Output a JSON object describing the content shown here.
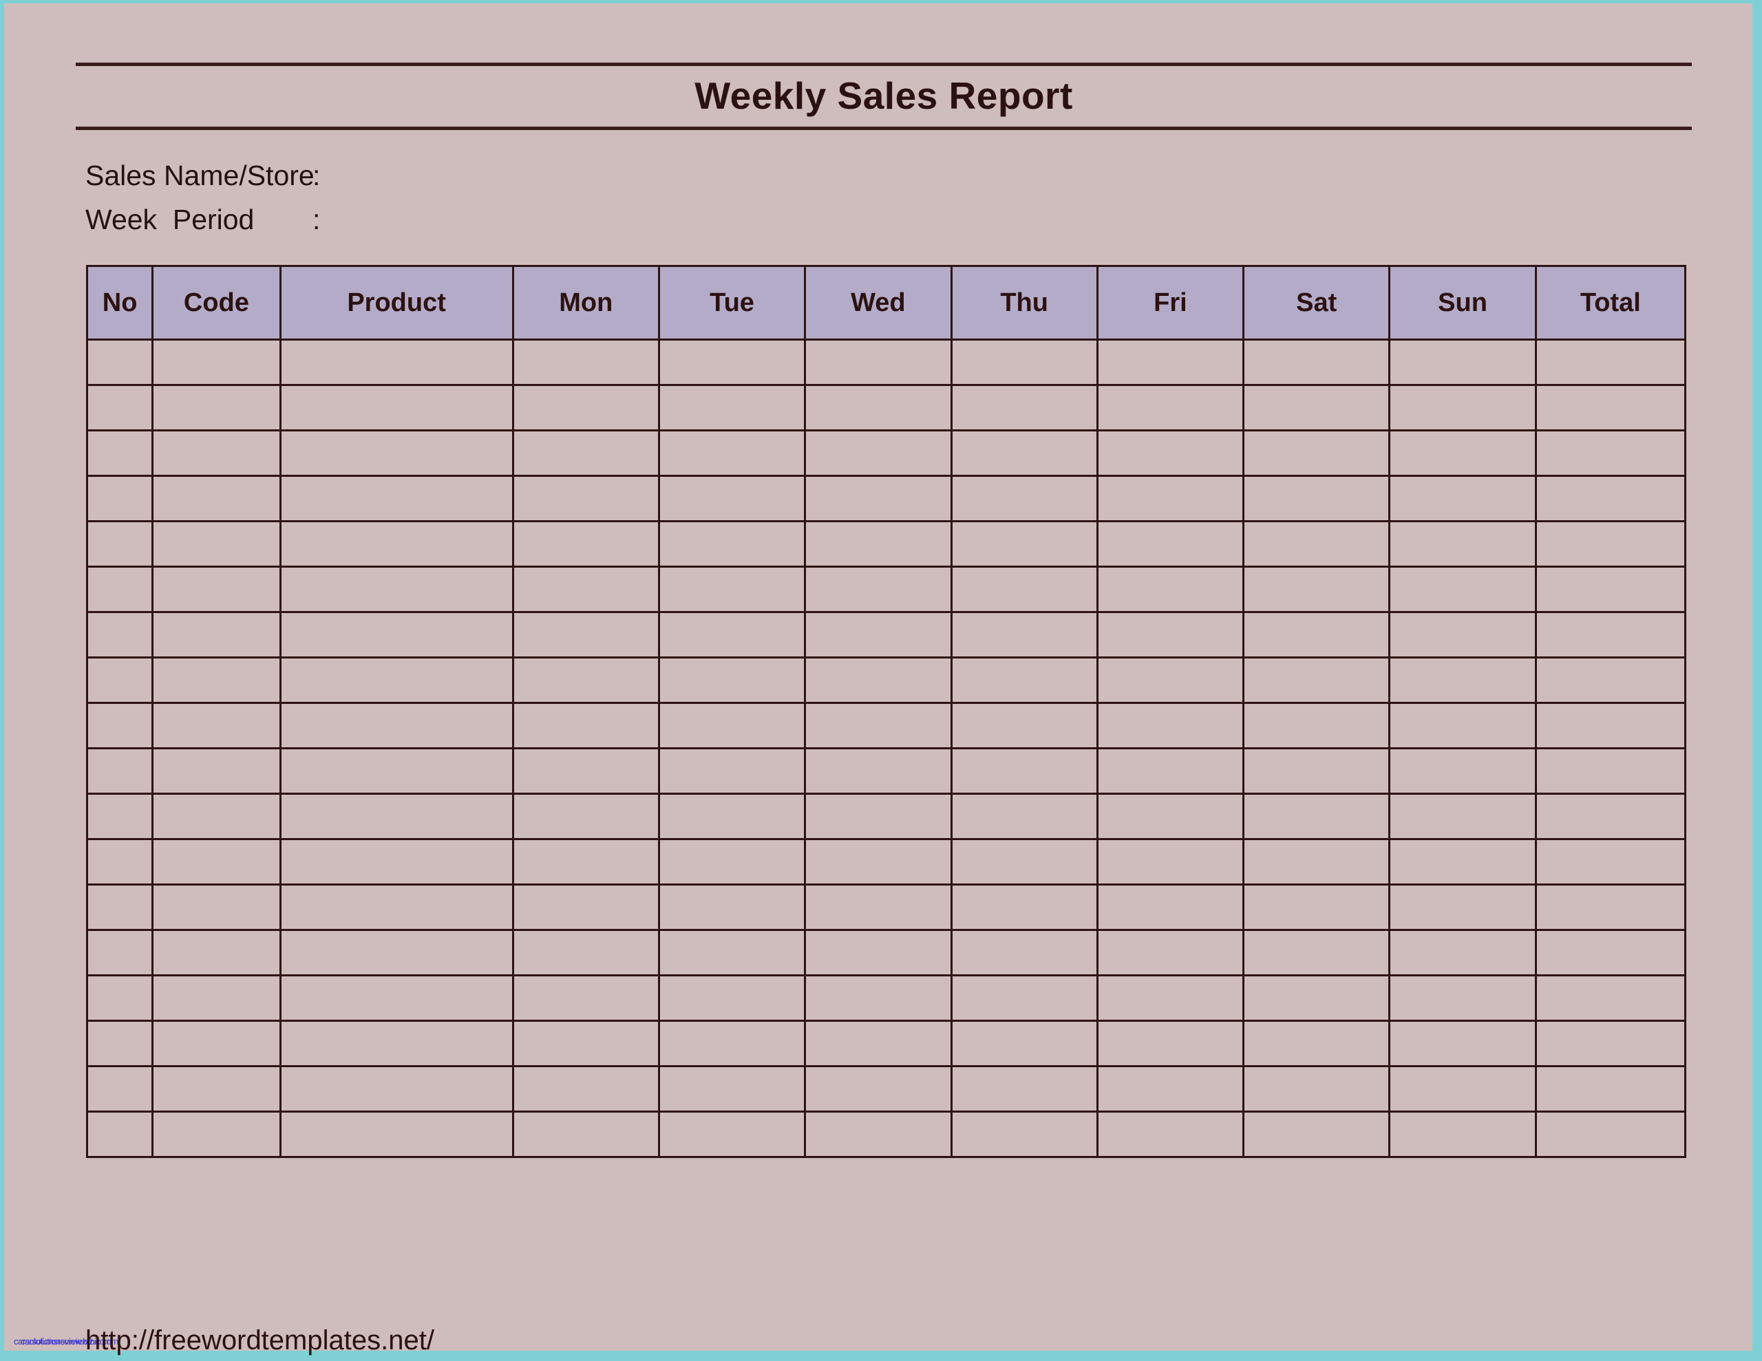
{
  "document": {
    "title": "Weekly Sales Report",
    "background_color": "#cfbcbc",
    "page_edge_color": "#7fd0d4",
    "rule_color": "#3a1c1c"
  },
  "meta": {
    "fields": [
      {
        "label": "Sales Name/Store",
        "colon": ":",
        "value": ""
      },
      {
        "label": "Week  Period",
        "colon": ":",
        "value": ""
      }
    ]
  },
  "table": {
    "header_background": "#b3abc7",
    "border_color": "#2e1414",
    "columns": [
      {
        "key": "no",
        "label": "No"
      },
      {
        "key": "code",
        "label": "Code"
      },
      {
        "key": "product",
        "label": "Product"
      },
      {
        "key": "mon",
        "label": "Mon"
      },
      {
        "key": "tue",
        "label": "Tue"
      },
      {
        "key": "wed",
        "label": "Wed"
      },
      {
        "key": "thu",
        "label": "Thu"
      },
      {
        "key": "fri",
        "label": "Fri"
      },
      {
        "key": "sat",
        "label": "Sat"
      },
      {
        "key": "sun",
        "label": "Sun"
      },
      {
        "key": "total",
        "label": "Total"
      }
    ],
    "row_count": 18,
    "rows": [
      [
        "",
        "",
        "",
        "",
        "",
        "",
        "",
        "",
        "",
        "",
        ""
      ],
      [
        "",
        "",
        "",
        "",
        "",
        "",
        "",
        "",
        "",
        "",
        ""
      ],
      [
        "",
        "",
        "",
        "",
        "",
        "",
        "",
        "",
        "",
        "",
        ""
      ],
      [
        "",
        "",
        "",
        "",
        "",
        "",
        "",
        "",
        "",
        "",
        ""
      ],
      [
        "",
        "",
        "",
        "",
        "",
        "",
        "",
        "",
        "",
        "",
        ""
      ],
      [
        "",
        "",
        "",
        "",
        "",
        "",
        "",
        "",
        "",
        "",
        ""
      ],
      [
        "",
        "",
        "",
        "",
        "",
        "",
        "",
        "",
        "",
        "",
        ""
      ],
      [
        "",
        "",
        "",
        "",
        "",
        "",
        "",
        "",
        "",
        "",
        ""
      ],
      [
        "",
        "",
        "",
        "",
        "",
        "",
        "",
        "",
        "",
        "",
        ""
      ],
      [
        "",
        "",
        "",
        "",
        "",
        "",
        "",
        "",
        "",
        "",
        ""
      ],
      [
        "",
        "",
        "",
        "",
        "",
        "",
        "",
        "",
        "",
        "",
        ""
      ],
      [
        "",
        "",
        "",
        "",
        "",
        "",
        "",
        "",
        "",
        "",
        ""
      ],
      [
        "",
        "",
        "",
        "",
        "",
        "",
        "",
        "",
        "",
        "",
        ""
      ],
      [
        "",
        "",
        "",
        "",
        "",
        "",
        "",
        "",
        "",
        "",
        ""
      ],
      [
        "",
        "",
        "",
        "",
        "",
        "",
        "",
        "",
        "",
        "",
        ""
      ],
      [
        "",
        "",
        "",
        "",
        "",
        "",
        "",
        "",
        "",
        "",
        ""
      ],
      [
        "",
        "",
        "",
        "",
        "",
        "",
        "",
        "",
        "",
        "",
        ""
      ],
      [
        "",
        "",
        "",
        "",
        "",
        "",
        "",
        "",
        "",
        "",
        ""
      ]
    ]
  },
  "footer": {
    "url": "http://freewordtemplates.net/",
    "watermark": "carsolutionsreview.biz.com",
    "watermark_color": "#2a24c8"
  }
}
